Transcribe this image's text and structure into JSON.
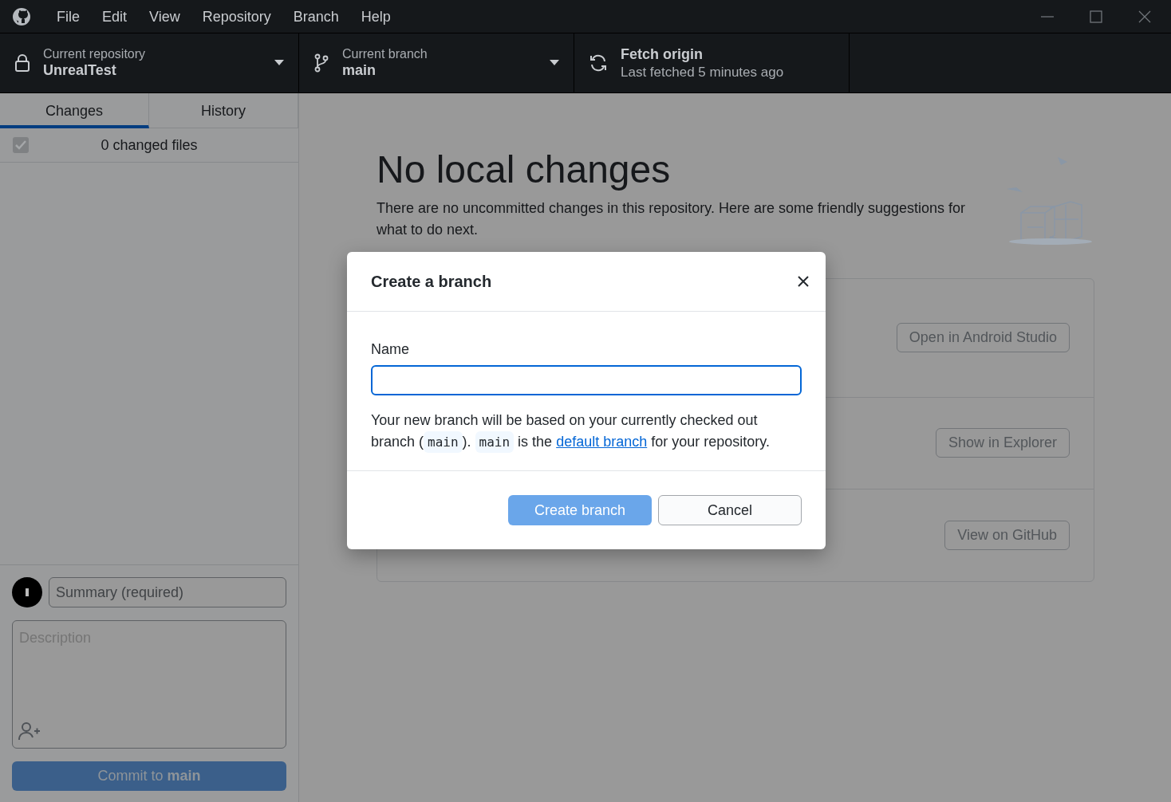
{
  "menu_bar": {
    "items": [
      "File",
      "Edit",
      "View",
      "Repository",
      "Branch",
      "Help"
    ]
  },
  "toolbar": {
    "repository": {
      "label": "Current repository",
      "value": "UnrealTest"
    },
    "branch": {
      "label": "Current branch",
      "value": "main"
    },
    "fetch": {
      "title": "Fetch origin",
      "subtitle": "Last fetched 5 minutes ago"
    }
  },
  "sidebar": {
    "tabs": [
      {
        "label": "Changes",
        "selected": true
      },
      {
        "label": "History",
        "selected": false
      }
    ],
    "changes_header": {
      "label": "0 changed files",
      "checked": true
    },
    "commit": {
      "summary_placeholder": "Summary (required)",
      "description_placeholder": "Description",
      "button": "Commit to **main**",
      "disabled": true
    }
  },
  "main": {
    "title": "No local changes",
    "description": "There are no uncommitted changes in this repository. Here are some friendly suggestions for what to do next.",
    "actions": [
      "Open in Android Studio",
      "Show in Explorer",
      "View on GitHub"
    ]
  },
  "dialog": {
    "title": "Create a branch",
    "field_label": "Name",
    "note": [
      {
        "kind": "text",
        "text": "Your new branch will be based on your currently checked out branch ("
      },
      {
        "kind": "code",
        "text": "main"
      },
      {
        "kind": "text",
        "text": "). "
      },
      {
        "kind": "code",
        "text": "main"
      },
      {
        "kind": "text",
        "text": " is the "
      },
      {
        "kind": "link",
        "text": "default branch"
      },
      {
        "kind": "text",
        "text": " for your repository."
      }
    ],
    "buttons": [
      {
        "label": "Create branch",
        "kind": "primary",
        "disabled": true
      },
      {
        "label": "Cancel",
        "kind": "secondary",
        "disabled": false
      }
    ]
  }
}
